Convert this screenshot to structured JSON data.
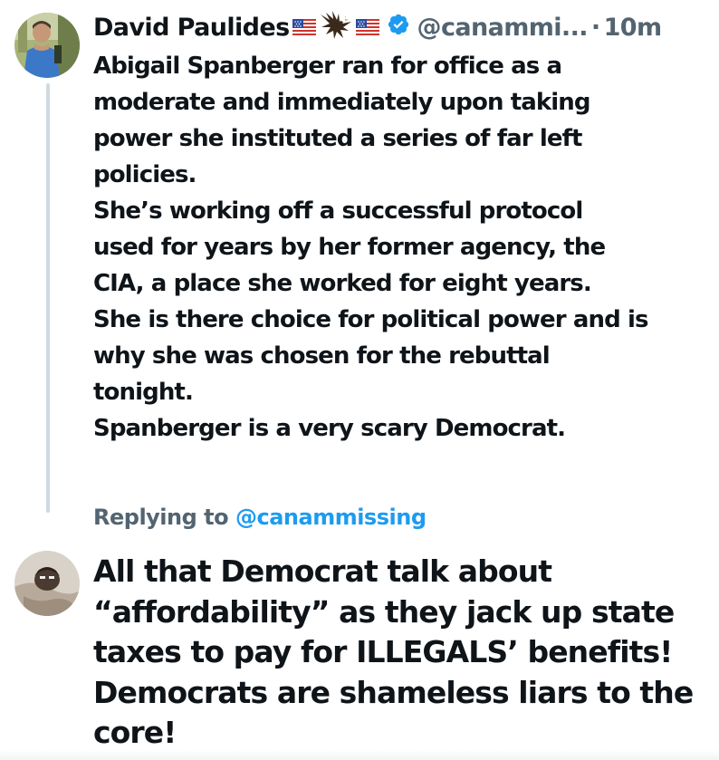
{
  "tweet": {
    "author_name": "David Paulides",
    "handle": "@canammi...",
    "separator": "·",
    "time": "10m",
    "verified": true,
    "name_emoji": [
      "us-flag-icon",
      "eagle-icon",
      "us-flag-icon"
    ],
    "lines": [
      "Abigail Spanberger ran for office as a",
      "moderate and immediately upon taking",
      "power she instituted a series of far left",
      "policies.",
      "She’s working off a successful protocol",
      "used for years by her former agency, the",
      "CIA, a place she worked for eight years.",
      "She is there choice for political power and is",
      "why she was chosen for the rebuttal",
      "tonight.",
      "Spanberger is a very scary Democrat."
    ]
  },
  "reply": {
    "replying_prefix": "Replying to",
    "replying_to": "@canammissing",
    "lines": [
      "All that Democrat talk about",
      "“affordability” as they jack up state",
      "taxes to pay for ILLEGALS’ benefits!",
      "Democrats are shameless liars to the",
      "core!"
    ]
  },
  "colors": {
    "text": "#0f1419",
    "secondary": "#536471",
    "link": "#1d9bf0",
    "thread_line": "#cfd9de"
  }
}
